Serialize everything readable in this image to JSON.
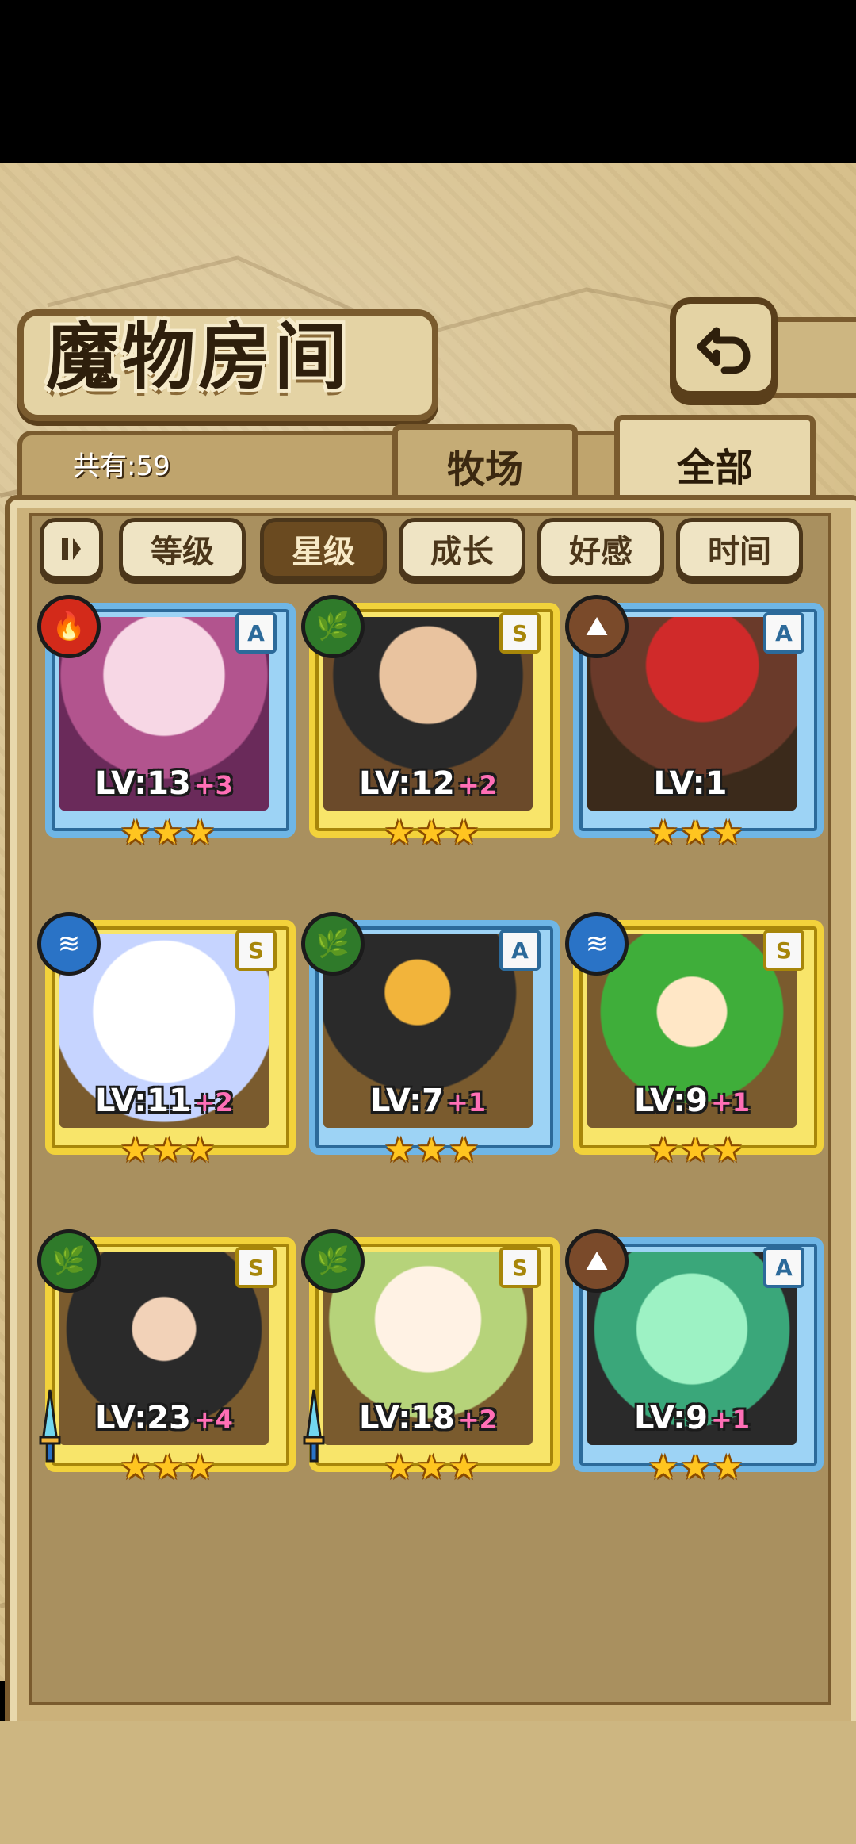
{
  "header": {
    "title": "魔物房间",
    "back_icon": "return-arrow-icon"
  },
  "collection": {
    "count_label": "共有:59"
  },
  "tabs": [
    {
      "label": "牧场",
      "active": false
    },
    {
      "label": "全部",
      "active": true
    }
  ],
  "sort_bar": {
    "toggle_icon": "pause-bars-icon",
    "options": [
      {
        "label": "等级",
        "active": false
      },
      {
        "label": "星级",
        "active": true
      },
      {
        "label": "成长",
        "active": false
      },
      {
        "label": "好感",
        "active": false
      },
      {
        "label": "时间",
        "active": false
      }
    ]
  },
  "monsters": [
    {
      "level": "LV:13",
      "plus": "+3",
      "rank": "A",
      "element": "fire",
      "frame": "blue",
      "stars": 3
    },
    {
      "level": "LV:12",
      "plus": "+2",
      "rank": "S",
      "element": "nature",
      "frame": "gold",
      "stars": 3
    },
    {
      "level": "LV:1",
      "plus": "",
      "rank": "A",
      "element": "earth",
      "frame": "blue",
      "stars": 3
    },
    {
      "level": "LV:11",
      "plus": "+2",
      "rank": "S",
      "element": "water",
      "frame": "gold",
      "stars": 3
    },
    {
      "level": "LV:7",
      "plus": "+1",
      "rank": "A",
      "element": "nature",
      "frame": "blue",
      "stars": 3
    },
    {
      "level": "LV:9",
      "plus": "+1",
      "rank": "S",
      "element": "water",
      "frame": "gold",
      "stars": 3
    },
    {
      "level": "LV:23",
      "plus": "+4",
      "rank": "S",
      "element": "nature",
      "frame": "gold",
      "stars": 3,
      "weapon": true
    },
    {
      "level": "LV:18",
      "plus": "+2",
      "rank": "S",
      "element": "nature",
      "frame": "gold",
      "stars": 3,
      "weapon": true
    },
    {
      "level": "LV:9",
      "plus": "+1",
      "rank": "A",
      "element": "earth",
      "frame": "blue",
      "stars": 3
    }
  ],
  "colors": {
    "fire": "#d32a1a",
    "nature": "#2f7a2a",
    "earth": "#7a4a2a",
    "water": "#2a73c6"
  }
}
